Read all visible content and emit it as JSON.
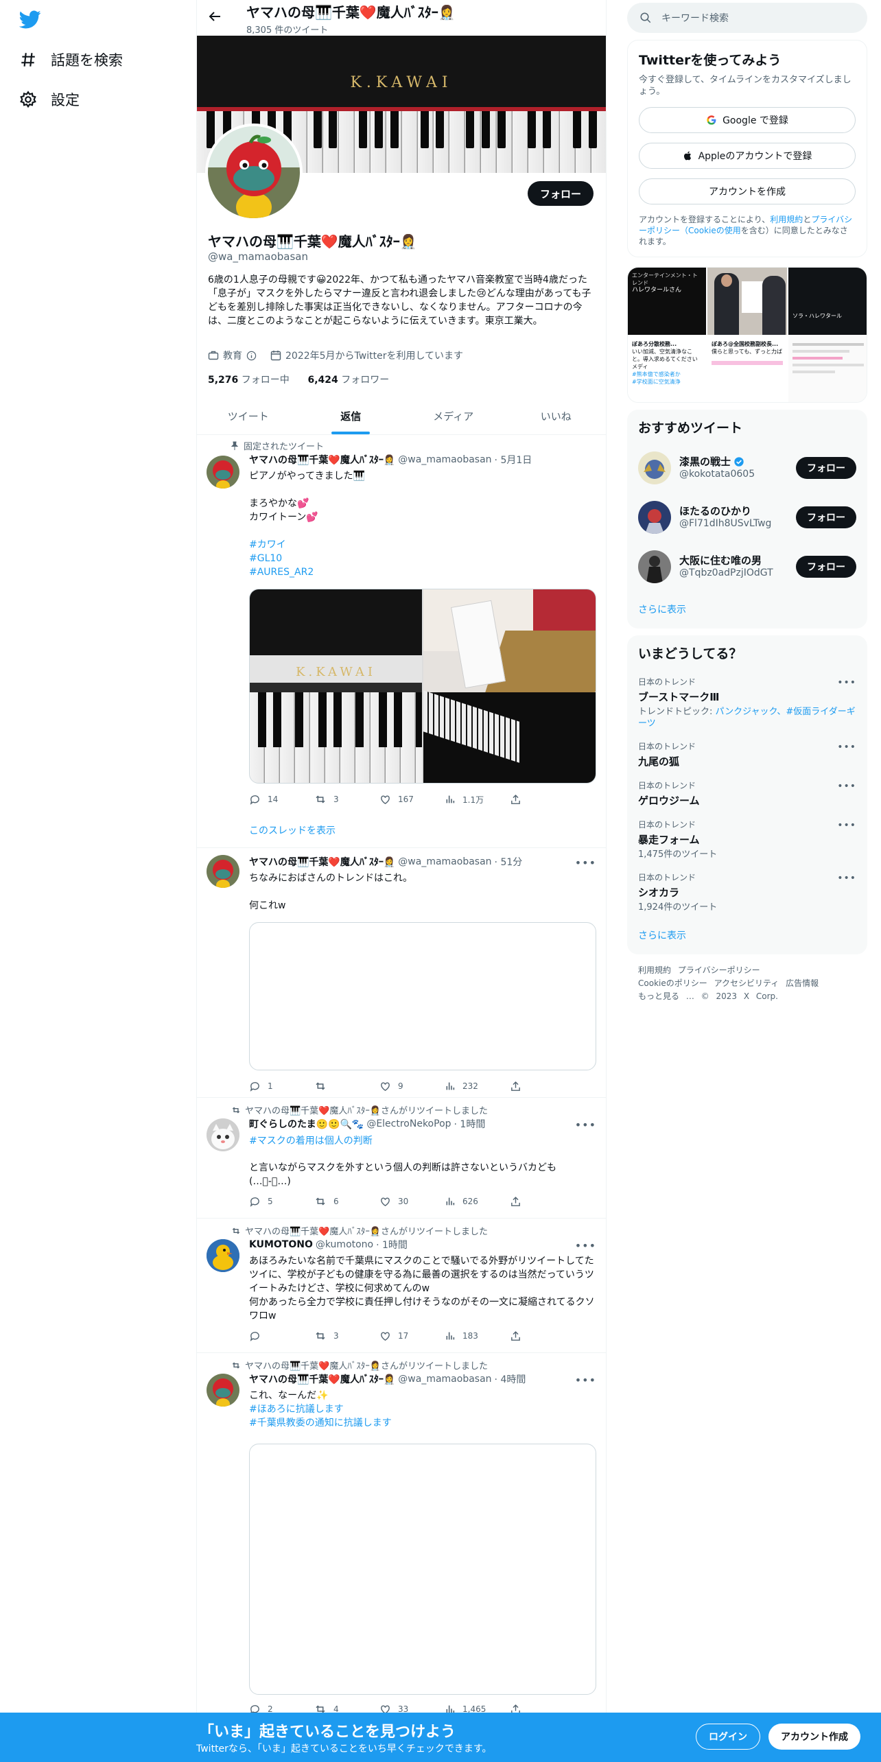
{
  "nav": {
    "explore_label": "話題を検索",
    "settings_label": "設定"
  },
  "header": {
    "name": "ヤマハの母🎹千葉❤️魔人ﾊﾞｽﾀｰ👩‍⚕️",
    "tweet_count": "8,305 件のツイート"
  },
  "banner_text": "K.KAWAI",
  "profile": {
    "name": "ヤマハの母🎹千葉❤️魔人ﾊﾞｽﾀｰ👩‍⚕️",
    "handle": "@wa_mamaobasan",
    "follow_label": "フォロー",
    "bio": "6歳の1人息子の母親です😀2022年、かつて私も通ったヤマハ音楽教室で当時4歳だった「息子が」マスクを外したらマナー違反と言われ退会しました😢どんな理由があっても子どもを差別し排除した事実は正当化できないし、なくなりません。アフターコロナの今は、二度とこのようなことが起こらないように伝えていきます。東京工業大。",
    "category": "教育",
    "joined": "2022年5月からTwitterを利用しています",
    "following_count": "5,276",
    "following_label": "フォロー中",
    "followers_count": "6,424",
    "followers_label": "フォロワー"
  },
  "tabs": [
    {
      "label": "ツイート"
    },
    {
      "label": "返信"
    },
    {
      "label": "メディア"
    },
    {
      "label": "いいね"
    }
  ],
  "tweets": {
    "t1": {
      "context": "固定されたツイート",
      "name": "ヤマハの母🎹千葉❤️魔人ﾊﾞｽﾀｰ👩‍⚕️",
      "handle": "@wa_mamaobasan",
      "time": "· 5月1日",
      "text": "ピアノがやってきました🎹\n\nまろやかな💕\nカワイトーン💕",
      "tags": [
        "#カワイ",
        "#GL10",
        "#AURES_AR2"
      ],
      "media_text": "K.KAWAI",
      "replies": "14",
      "retweets": "3",
      "likes": "167",
      "views": "1.1万",
      "thread_link": "このスレッドを表示"
    },
    "t2": {
      "name": "ヤマハの母🎹千葉❤️魔人ﾊﾞｽﾀｰ👩‍⚕️",
      "handle": "@wa_mamaobasan",
      "time": "· 51分",
      "text": "ちなみにおばさんのトレンドはこれ。\n\n何これw",
      "replies": "1",
      "retweets": "",
      "likes": "9",
      "views": "232"
    },
    "t3": {
      "context": "ヤマハの母🎹千葉❤️魔人ﾊﾞｽﾀｰ👩‍⚕️さんがリツイートしました",
      "name": "町ぐらしのたま🙂🙂🔍🐾",
      "handle": "@ElectroNekoPop",
      "time": "· 1時間",
      "tag": "#マスクの着用は個人の判断",
      "text": "と言いながらマスクを外すという個人の判断は許さないというバカども\n(…ﾟ-ﾟ…)",
      "replies": "5",
      "retweets": "6",
      "likes": "30",
      "views": "626"
    },
    "t4": {
      "context": "ヤマハの母🎹千葉❤️魔人ﾊﾞｽﾀｰ👩‍⚕️さんがリツイートしました",
      "name": "KUMOTONO",
      "handle": "@kumotono",
      "time": "· 1時間",
      "text": "あほろみたいな名前で千葉県にマスクのことで騒いでる外野がリツイートしてたツイに、学校が子どもの健康を守る為に最善の選択をするのは当然だっていうツイートみたけどさ、学校に何求めてんのw\n何かあったら全力で学校に責任押し付けそうなのがその一文に凝縮されてるクソワロw",
      "replies": "",
      "retweets": "3",
      "likes": "17",
      "views": "183"
    },
    "t5": {
      "context": "ヤマハの母🎹千葉❤️魔人ﾊﾞｽﾀｰ👩‍⚕️さんがリツイートしました",
      "name": "ヤマハの母🎹千葉❤️魔人ﾊﾞｽﾀｰ👩‍⚕️",
      "handle": "@wa_mamaobasan",
      "time": "· 4時間",
      "text": "これ、なーんだ✨",
      "tags": [
        "#ほあろに抗議します",
        "#千葉県教委の通知に抗議します"
      ],
      "replies": "2",
      "retweets": "4",
      "likes": "33",
      "views": "1,465"
    }
  },
  "right": {
    "search_placeholder": "キーワード検索",
    "signup": {
      "title": "Twitterを使ってみよう",
      "subtitle": "今すぐ登録して、タイムラインをカスタマイズしましょう。",
      "google": "Google で登録",
      "apple": "Appleのアカウントで登録",
      "create": "アカウントを作成",
      "legal_1": "アカウントを登録することにより、",
      "legal_terms": "利用規約",
      "legal_2": "と",
      "legal_privacy": "プライバシーポリシー（Cookieの使用",
      "legal_3": "を含む）に同意したとみなされます。"
    },
    "photos": {
      "p1_top": "エンターテインメント・トレンド",
      "p1_name": "ハレワタールさん",
      "p3_label": "ソラ・ハレワタール",
      "p4_head": "ぼあろ分散校務...",
      "p4_text": "いい加減、空気清浄なこと。導入求めるてください メディ",
      "p4_tag1": "#熊本億で感染者か",
      "p4_tag2": "#学校面に空気清浄",
      "p5_head": "ぼあろ@全国校務副校長...",
      "p5_text": "僕らと思っても、ずっと力ば"
    },
    "recommend": {
      "title": "おすすめツイート",
      "users": [
        {
          "name": "漆黒の戦士",
          "handle": "@kokotata0605",
          "button": "フォロー"
        },
        {
          "name": "ほたるのひかり",
          "handle": "@Fl71dIh8USvLTwg",
          "button": "フォロー"
        },
        {
          "name": "大阪に住む唯の男",
          "handle": "@Tqbz0adPzjIOdGT",
          "button": "フォロー"
        }
      ],
      "more": "さらに表示"
    },
    "trends": {
      "title": "いまどうしてる？",
      "items": [
        {
          "category": "日本のトレンド",
          "topic": "ブーストマークⅢ",
          "extra_label": "トレンドトピック: ",
          "extra_links": "パンクジャック、#仮面ライダーギーツ"
        },
        {
          "category": "日本のトレンド",
          "topic": "九尾の狐"
        },
        {
          "category": "日本のトレンド",
          "topic": "ゲロウジーム"
        },
        {
          "category": "日本のトレンド",
          "topic": "暴走フォーム",
          "count": "1,475件のツイート"
        },
        {
          "category": "日本のトレンド",
          "topic": "シオカラ",
          "count": "1,924件のツイート"
        }
      ],
      "more": "さらに表示"
    },
    "footer": {
      "terms": "利用規約",
      "privacy": "プライバシーポリシー",
      "cookie": "Cookieのポリシー",
      "accessibility": "アクセシビリティ",
      "ads": "広告情報",
      "more": "もっと見る …",
      "copyright": "© 2023 X Corp."
    }
  },
  "bottom": {
    "headline": "「いま」起きていることを見つけよう",
    "sub": "Twitterなら、「いま」起きていることをいち早くチェックできます。",
    "login": "ログイン",
    "signup": "アカウント作成"
  }
}
